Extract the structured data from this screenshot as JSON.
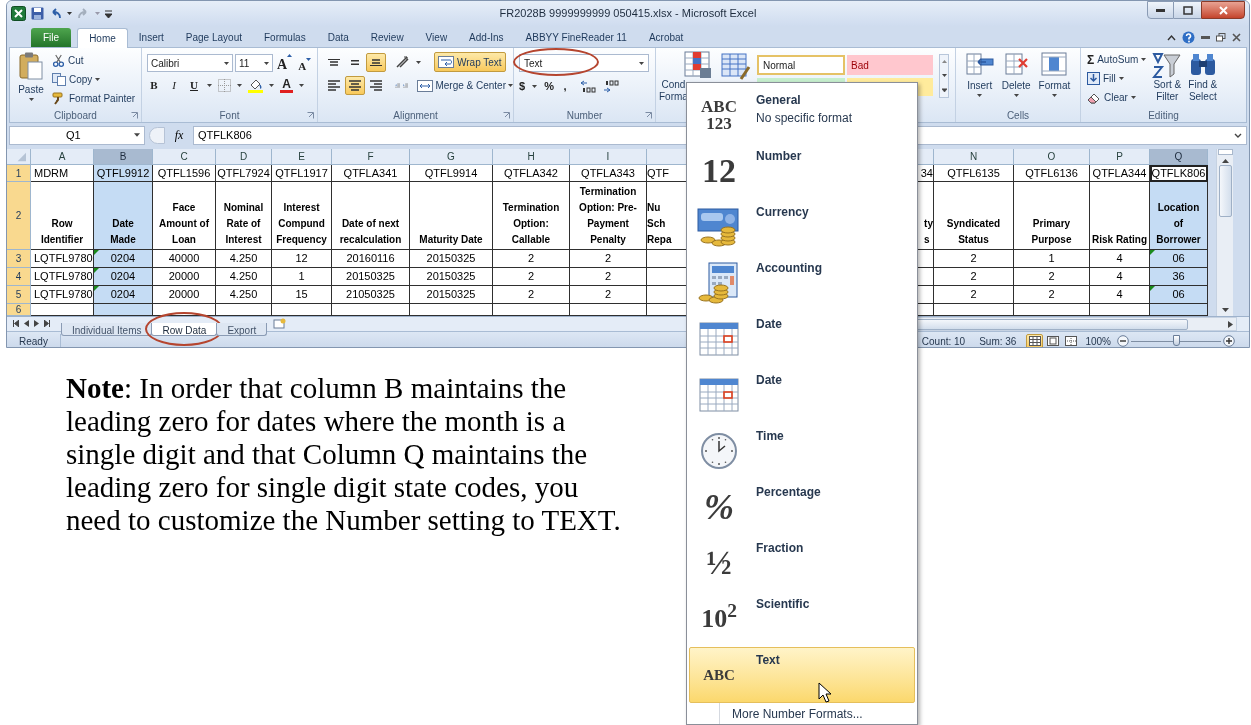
{
  "window": {
    "title": "FR2028B 9999999999 050415.xlsx  -  Microsoft Excel"
  },
  "ribbon_tabs": [
    {
      "label": "File",
      "kind": "file",
      "selected": false
    },
    {
      "label": "Home",
      "kind": "tab",
      "selected": true
    },
    {
      "label": "Insert",
      "kind": "tab",
      "selected": false
    },
    {
      "label": "Page Layout",
      "kind": "tab",
      "selected": false
    },
    {
      "label": "Formulas",
      "kind": "tab",
      "selected": false
    },
    {
      "label": "Data",
      "kind": "tab",
      "selected": false
    },
    {
      "label": "Review",
      "kind": "tab",
      "selected": false
    },
    {
      "label": "View",
      "kind": "tab",
      "selected": false
    },
    {
      "label": "Add-Ins",
      "kind": "tab",
      "selected": false
    },
    {
      "label": "ABBYY FineReader 11",
      "kind": "tab",
      "selected": false
    },
    {
      "label": "Acrobat",
      "kind": "tab",
      "selected": false
    }
  ],
  "ribbon": {
    "clipboard": {
      "paste": "Paste",
      "cut": "Cut",
      "copy": "Copy",
      "format_painter": "Format Painter",
      "label": "Clipboard"
    },
    "font": {
      "name": "Calibri",
      "size": "11",
      "grow": "A",
      "shrink": "A",
      "bold": "B",
      "italic": "I",
      "underline": "U",
      "font_color": "A",
      "label": "Font"
    },
    "alignment": {
      "vertical": [
        {
          "on": false
        },
        {
          "on": false
        },
        {
          "on": true
        }
      ],
      "horizontal": [
        {
          "on": false
        },
        {
          "on": true
        },
        {
          "on": false
        }
      ],
      "wrap_text": {
        "label": "Wrap Text",
        "on": true
      },
      "merge": "Merge & Center",
      "label": "Alignment"
    },
    "number": {
      "format": "Text",
      "circled": true,
      "currency": "$",
      "percent": "%",
      "comma": ",",
      "label": "Number"
    },
    "styles": {
      "conditional_formatting": "Cond\nForma",
      "normal": "Normal",
      "bad": "Bad"
    },
    "cells": {
      "insert": "Insert",
      "delete": "Delete",
      "format": "Format",
      "label": "Cells"
    },
    "editing": {
      "autosum_glyph": "Σ",
      "autosum": "AutoSum",
      "fill": "Fill",
      "clear": "Clear",
      "sort": "Sort &\nFilter",
      "find": "Find &\nSelect",
      "label": "Editing"
    }
  },
  "formula_bar": {
    "name_box": "Q1",
    "fx": "fx",
    "formula": "QTFLK806"
  },
  "sheet": {
    "columns": [
      {
        "letter": "A",
        "kind": "full",
        "selected": false
      },
      {
        "letter": "B",
        "kind": "full",
        "selected": true
      },
      {
        "letter": "C",
        "kind": "full",
        "selected": false
      },
      {
        "letter": "D",
        "kind": "full",
        "selected": false
      },
      {
        "letter": "E",
        "kind": "full",
        "selected": false
      },
      {
        "letter": "F",
        "kind": "full",
        "selected": false
      },
      {
        "letter": "G",
        "kind": "full",
        "selected": false
      },
      {
        "letter": "H",
        "kind": "full",
        "selected": false
      },
      {
        "letter": "I",
        "kind": "full",
        "selected": false
      },
      {
        "kind": "cut_right",
        "selected": false
      },
      {
        "kind": "cut_left",
        "selected": false
      },
      {
        "letter": "N",
        "kind": "full",
        "selected": false
      },
      {
        "letter": "O",
        "kind": "full",
        "selected": false
      },
      {
        "letter": "P",
        "kind": "full",
        "selected": false
      },
      {
        "letter": "Q",
        "kind": "full",
        "selected": true
      }
    ],
    "rows": [
      {
        "number": "1",
        "selected": true,
        "bold": false,
        "cells": [
          "MDRM",
          "QTFL9912",
          "QTFL1596",
          "QTFL7924",
          "QTFL1917",
          "QTFLA341",
          "QTFL9914",
          "QTFLA342",
          "QTFLA343",
          "QTF",
          "34",
          "QTFL6135",
          "QTFL6136",
          "QTFLA344",
          {
            "text": "QTFLK806",
            "active": true
          }
        ]
      },
      {
        "number": "2",
        "selected": true,
        "bold": true,
        "cells": [
          "Row\nIdentifier",
          "Date\nMade",
          "Face\nAmount of\nLoan",
          "Nominal\nRate of\nInterest",
          "Interest\nCompund\nFrequency",
          "Date of next\nrecalculation",
          "Maturity Date",
          "Termination\nOption:\nCallable",
          "Termination\nOption: Pre-\nPayment\nPenalty",
          "Nu\nSch\nRepa",
          "ty\ns",
          "Syndicated\nStatus",
          "Primary\nPurpose",
          "Risk Rating",
          "Location\nof\nBorrower"
        ]
      },
      {
        "number": "3",
        "selected": true,
        "bold": false,
        "cells": [
          "LQTFL9780",
          {
            "text": "0204",
            "flagged": true
          },
          "40000",
          "4.250",
          "12",
          "20160116",
          "20150325",
          "2",
          "2",
          null,
          null,
          "2",
          "1",
          "4",
          {
            "text": "06",
            "flagged": true
          }
        ]
      },
      {
        "number": "4",
        "selected": true,
        "bold": false,
        "cells": [
          "LQTFL9780",
          {
            "text": "0204",
            "flagged": true
          },
          "20000",
          "4.250",
          "1",
          "20150325",
          "20150325",
          "2",
          "2",
          null,
          null,
          "2",
          "2",
          "4",
          "36"
        ]
      },
      {
        "number": "5",
        "selected": true,
        "bold": false,
        "cells": [
          "LQTFL9780",
          {
            "text": "0204",
            "flagged": true
          },
          "20000",
          "4.250",
          "15",
          "21050325",
          "20150325",
          "2",
          "2",
          null,
          null,
          "2",
          "2",
          "4",
          {
            "text": "06",
            "flagged": true
          }
        ]
      },
      {
        "number": "6",
        "selected": true,
        "bold": false,
        "cells": [
          null,
          null,
          null,
          null,
          null,
          null,
          null,
          null,
          null,
          null,
          null,
          null,
          null,
          null,
          null
        ]
      }
    ]
  },
  "sheet_tabs": [
    {
      "label": "Individual Items",
      "selected": false,
      "circled": false
    },
    {
      "label": "Row Data",
      "selected": true,
      "circled": true
    },
    {
      "label": "Export",
      "selected": false,
      "circled": false
    }
  ],
  "status_bar": {
    "ready": "Ready",
    "count": "Count: 10",
    "sum": "Sum: 36",
    "views": [
      {
        "selected": true
      },
      {
        "selected": false
      },
      {
        "selected": false
      }
    ],
    "zoom": "100%",
    "zoom_slider": {
      "level": 0.5
    }
  },
  "number_format_menu": {
    "items": [
      {
        "kind": "stacked",
        "glyph": "ABC\n123",
        "label": "General",
        "description": "No specific format",
        "selected": false
      },
      {
        "kind": "large",
        "glyph": "12",
        "label": "Number",
        "selected": false
      },
      {
        "kind": "currency",
        "label": "Currency",
        "selected": false
      },
      {
        "kind": "accounting",
        "label": "Accounting",
        "selected": false
      },
      {
        "kind": "date",
        "label": "Date",
        "selected": false
      },
      {
        "kind": "date",
        "label": "Date",
        "selected": false
      },
      {
        "kind": "time",
        "label": "Time",
        "selected": false
      },
      {
        "kind": "large_italic",
        "glyph": "%",
        "label": "Percentage",
        "selected": false
      },
      {
        "kind": "large",
        "glyph": "½",
        "label": "Fraction",
        "selected": false
      },
      {
        "kind": "medium",
        "glyph": "10$^{2}$",
        "label": "Scientific",
        "selected": false
      },
      {
        "kind": "small",
        "glyph": "ABC",
        "label": "Text",
        "selected": true
      }
    ],
    "more": "More Number Formats..."
  },
  "note": "**Note**: In order that column B maintains the leading zero for dates where the month is a single digit and that Column Q maintains the leading zero for single digit state codes, you need to customize the Number setting to TEXT."
}
